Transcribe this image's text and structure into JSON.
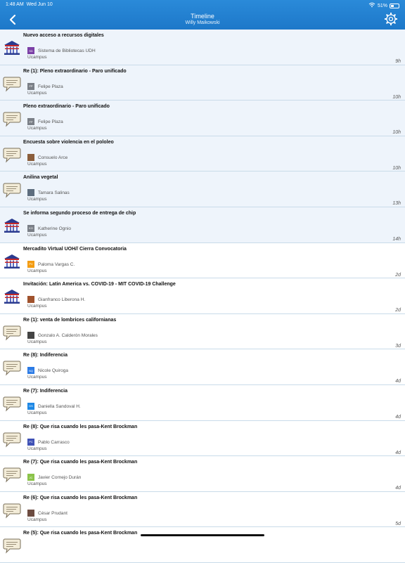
{
  "status": {
    "time": "1:48 AM",
    "date": "Wed Jun 10",
    "battery": "51%",
    "battery_level": 0.51
  },
  "header": {
    "title": "Timeline",
    "subtitle": "Willy Maikowski"
  },
  "items": [
    {
      "title": "Nuevo acceso a recursos digitales",
      "initials": "SD",
      "author": "Sistema de Bibliotecas UDH",
      "source": "Ucampus",
      "time": "9h",
      "icon": "library-icon",
      "avatar_color": "#7b3fa6",
      "unread": true
    },
    {
      "title": "Re (1): Pleno extraordinario - Paro unificado",
      "initials": "FP",
      "author": "Felipe Plaza",
      "source": "Ucampus",
      "time": "10h",
      "icon": "speech-bubble-icon",
      "avatar_color": "#7a7f87",
      "unread": true
    },
    {
      "title": "Pleno extraordinario - Paro unificado",
      "initials": "FP",
      "author": "Felipe Plaza",
      "source": "Ucampus",
      "time": "10h",
      "icon": "speech-bubble-icon",
      "avatar_color": "#7a7f87",
      "unread": true
    },
    {
      "title": "Encuesta sobre violencia en el pololeo",
      "initials": "",
      "author": "Consuelo Arce",
      "source": "Ucampus",
      "time": "10h",
      "icon": "speech-bubble-icon",
      "avatar_color": "#8b5e3c",
      "unread": true
    },
    {
      "title": "Anilina vegetal",
      "initials": "",
      "author": "Tamara Salinas",
      "source": "Ucampus",
      "time": "13h",
      "icon": "speech-bubble-icon",
      "avatar_color": "#5d6d7e",
      "unread": true
    },
    {
      "title": "Se informa segundo proceso de entrega de chip",
      "initials": "KO",
      "author": "Katherine Ognio",
      "source": "Ucampus",
      "time": "14h",
      "icon": "library-icon",
      "avatar_color": "#7a7f87",
      "unread": true
    },
    {
      "title": "Mercadito Virtual UOH// Cierra Convocatoria",
      "initials": "PV",
      "author": "Paloma Vargas C.",
      "source": "Ucampus",
      "time": "2d",
      "icon": "library-icon",
      "avatar_color": "#f39c12",
      "unread": false
    },
    {
      "title": "Invitación: Latin America vs. COVID-19 - MIT COVID-19 Challenge",
      "initials": "",
      "author": "Gianfranco Liberona H.",
      "source": "Ucampus",
      "time": "2d",
      "icon": "library-icon",
      "avatar_color": "#a0522d",
      "unread": false
    },
    {
      "title": "Re (1): venta de lombrices californianas",
      "initials": "",
      "author": "Gonzalo A. Calderón Morales",
      "source": "Ucampus",
      "time": "3d",
      "icon": "speech-bubble-icon",
      "avatar_color": "#444444",
      "unread": false
    },
    {
      "title": "Re (8): Indiferencia",
      "initials": "NQ",
      "author": "Nicole Quiroga",
      "source": "Ucampus",
      "time": "4d",
      "icon": "speech-bubble-icon",
      "avatar_color": "#2c7be5",
      "unread": false
    },
    {
      "title": "Re (7): Indiferencia",
      "initials": "DS",
      "author": "Daniella Sandoval H.",
      "source": "Ucampus",
      "time": "4d",
      "icon": "speech-bubble-icon",
      "avatar_color": "#1e88e5",
      "unread": false
    },
    {
      "title": "Re (8): Que risa cuando les pasa-Kent Brockman",
      "initials": "PC",
      "author": "Pablo Carrasco",
      "source": "Ucampus",
      "time": "4d",
      "icon": "speech-bubble-icon",
      "avatar_color": "#3f51b5",
      "unread": false
    },
    {
      "title": "Re (7): Que risa cuando les pasa-Kent Brockman",
      "initials": "JC",
      "author": "Javier Cornejo Durán",
      "source": "Ucampus",
      "time": "4d",
      "icon": "speech-bubble-icon",
      "avatar_color": "#8bc34a",
      "unread": false
    },
    {
      "title": "Re (6): Que risa cuando les pasa-Kent Brockman",
      "initials": "",
      "author": "César Prudant",
      "source": "Ucampus",
      "time": "5d",
      "icon": "speech-bubble-icon",
      "avatar_color": "#6d4c41",
      "unread": false
    },
    {
      "title": "Re (5): Que risa cuando les pasa-Kent Brockman",
      "initials": "",
      "author": "",
      "source": "",
      "time": "",
      "icon": "speech-bubble-icon",
      "avatar_color": "#6d4c41",
      "unread": false
    }
  ]
}
